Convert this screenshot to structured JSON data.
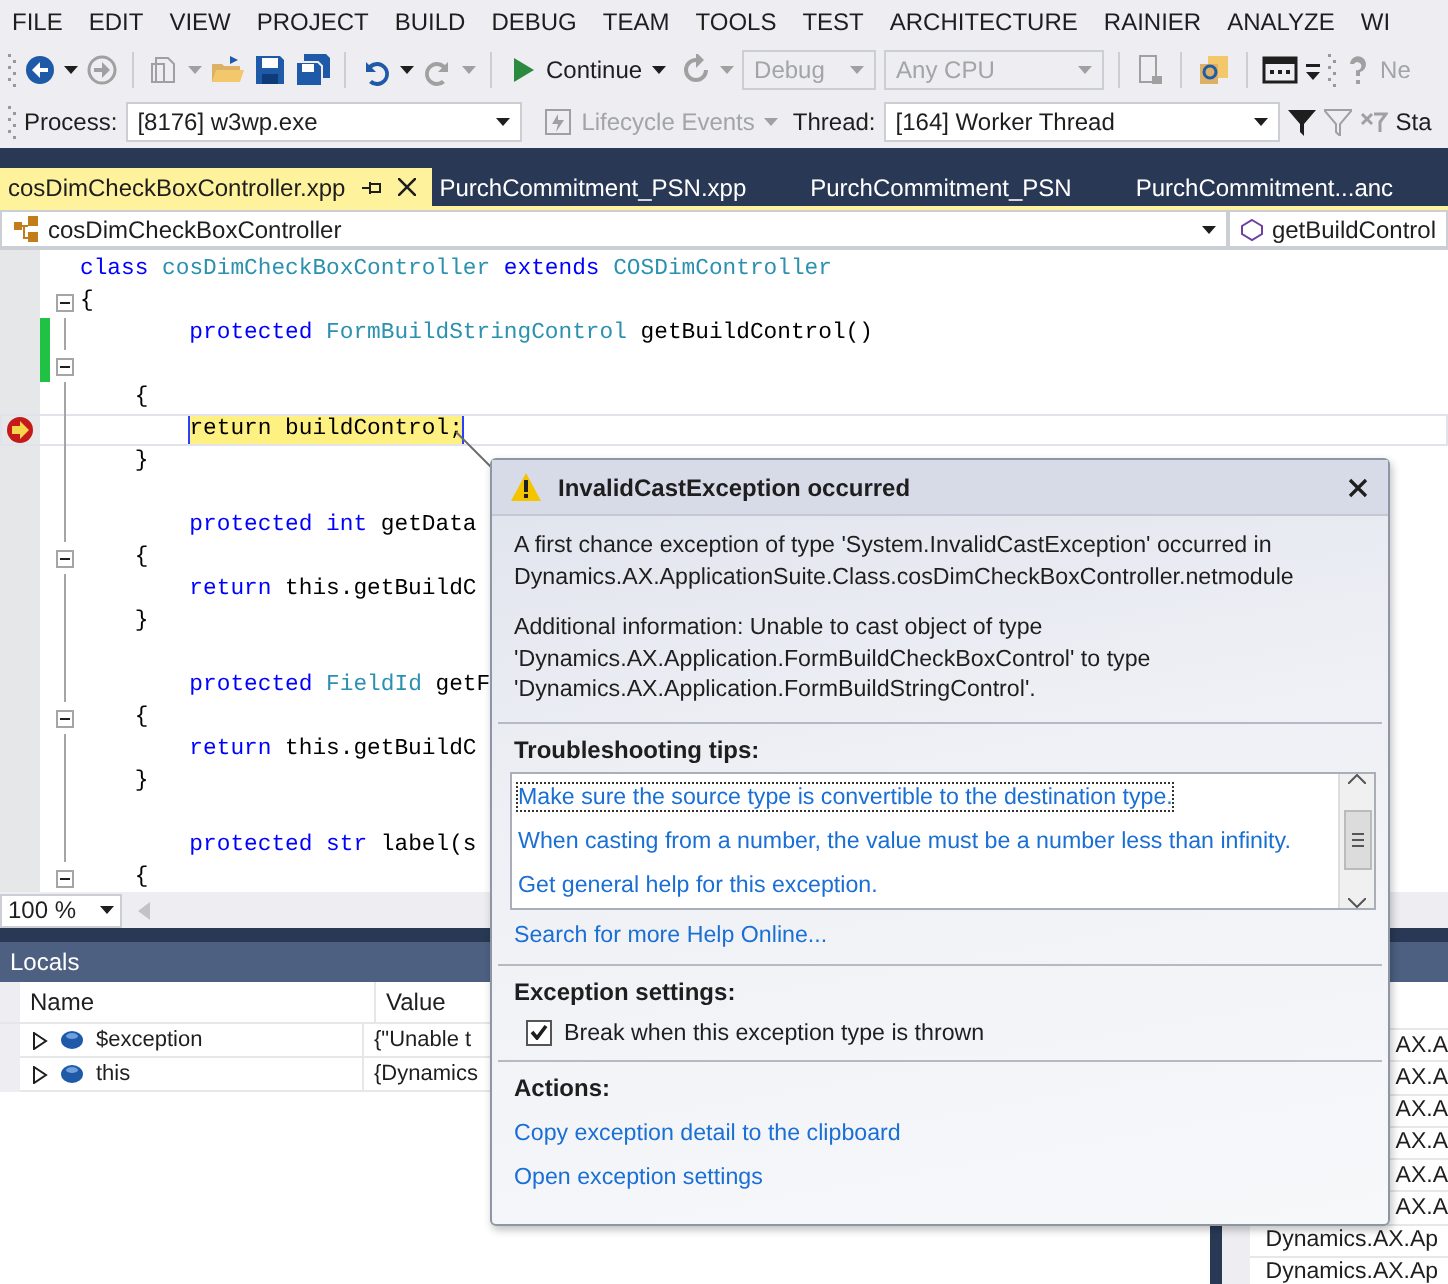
{
  "menu": [
    "FILE",
    "EDIT",
    "VIEW",
    "PROJECT",
    "BUILD",
    "DEBUG",
    "TEAM",
    "TOOLS",
    "TEST",
    "ARCHITECTURE",
    "RAINIER",
    "ANALYZE",
    "WI"
  ],
  "toolbar": {
    "continue": "Continue",
    "configuration": {
      "value": "Debug",
      "disabled": true
    },
    "platform": {
      "value": "Any CPU",
      "disabled": true
    },
    "cut_label": "Ne"
  },
  "debug_location": {
    "process_label": "Process:",
    "process": "[8176] w3wp.exe",
    "lifecycle": {
      "label": "Lifecycle Events",
      "disabled": true
    },
    "thread_label": "Thread:",
    "thread": "[164] Worker Thread",
    "cut_label": "Sta"
  },
  "tabs": [
    {
      "label": "cosDimCheckBoxController.xpp",
      "selected": true
    },
    {
      "label": "PurchCommitment_PSN.xpp",
      "selected": false
    },
    {
      "label": "PurchCommitment_PSN",
      "selected": false
    },
    {
      "label": "PurchCommitment...anc",
      "selected": false
    }
  ],
  "navigation": {
    "type": "cosDimCheckBoxController",
    "member": "getBuildControl"
  },
  "code": [
    {
      "tokens": [
        {
          "text": "class",
          "kind": "keyword"
        },
        {
          "text": " cosDimCheckBoxController",
          "kind": "type"
        },
        {
          "text": " extends",
          "kind": "keyword"
        },
        {
          "text": " COSDimController",
          "kind": "type"
        }
      ],
      "current": false,
      "changed": false,
      "fold": false
    },
    {
      "tokens": [
        {
          "text": "{",
          "kind": "plain"
        }
      ],
      "current": false,
      "changed": false,
      "fold": true
    },
    {
      "tokens": [
        {
          "text": "        protected",
          "kind": "keyword"
        },
        {
          "text": " FormBuildStringControl",
          "kind": "type"
        },
        {
          "text": " getBuildControl()",
          "kind": "plain"
        }
      ],
      "current": false,
      "changed": true,
      "fold": false
    },
    {
      "current": false,
      "changed": true,
      "fold": true
    },
    {
      "tokens": [
        {
          "text": "    {",
          "kind": "plain"
        }
      ],
      "current": false,
      "changed": false,
      "fold": false
    },
    {
      "tokens": [
        {
          "text": "        return",
          "kind": "plain"
        },
        {
          "text": " buildControl;",
          "kind": "plain"
        }
      ],
      "current": true,
      "changed": false,
      "fold": false
    },
    {
      "tokens": [
        {
          "text": "    }",
          "kind": "plain"
        }
      ],
      "current": false,
      "changed": false,
      "fold": false
    },
    {
      "current": false,
      "changed": false,
      "fold": false
    },
    {
      "tokens": [
        {
          "text": "        protected",
          "kind": "keyword"
        },
        {
          "text": " int",
          "kind": "keyword"
        },
        {
          "text": " getData",
          "kind": "plain"
        }
      ],
      "current": false,
      "changed": false,
      "fold": false
    },
    {
      "tokens": [
        {
          "text": "    {",
          "kind": "plain"
        }
      ],
      "current": false,
      "changed": false,
      "fold": true
    },
    {
      "tokens": [
        {
          "text": "        return",
          "kind": "keyword"
        },
        {
          "text": " this.getBuildC",
          "kind": "plain"
        }
      ],
      "current": false,
      "changed": false,
      "fold": false
    },
    {
      "tokens": [
        {
          "text": "    }",
          "kind": "plain"
        }
      ],
      "current": false,
      "changed": false,
      "fold": false
    },
    {
      "current": false,
      "changed": false,
      "fold": false
    },
    {
      "tokens": [
        {
          "text": "        protected",
          "kind": "keyword"
        },
        {
          "text": " FieldId",
          "kind": "type"
        },
        {
          "text": " getF",
          "kind": "plain"
        }
      ],
      "current": false,
      "changed": false,
      "fold": false
    },
    {
      "tokens": [
        {
          "text": "    {",
          "kind": "plain"
        }
      ],
      "current": false,
      "changed": false,
      "fold": true
    },
    {
      "tokens": [
        {
          "text": "        return",
          "kind": "keyword"
        },
        {
          "text": " this.getBuildC",
          "kind": "plain"
        }
      ],
      "current": false,
      "changed": false,
      "fold": false
    },
    {
      "tokens": [
        {
          "text": "    }",
          "kind": "plain"
        }
      ],
      "current": false,
      "changed": false,
      "fold": false
    },
    {
      "current": false,
      "changed": false,
      "fold": false
    },
    {
      "tokens": [
        {
          "text": "        protected",
          "kind": "keyword"
        },
        {
          "text": " str",
          "kind": "keyword"
        },
        {
          "text": " label(s",
          "kind": "plain"
        }
      ],
      "current": false,
      "changed": false,
      "fold": false
    },
    {
      "tokens": [
        {
          "text": "    {",
          "kind": "plain"
        }
      ],
      "current": false,
      "changed": false,
      "fold": true
    }
  ],
  "zoom": "100 %",
  "popup": {
    "title": "InvalidCastException occurred",
    "message": "A first chance exception of type 'System.InvalidCastException' occurred in\nDynamics.AX.ApplicationSuite.Class.cosDimCheckBoxController.netmodule",
    "details": "Additional information: Unable to cast object of type\n'Dynamics.AX.Application.FormBuildCheckBoxControl' to type\n'Dynamics.AX.Application.FormBuildStringControl'.",
    "tips_heading": "Troubleshooting tips:",
    "tips": [
      {
        "text": "Make sure the source type is convertible to the destination type.",
        "focused": true
      },
      {
        "text": "When casting from a number, the value must be a number less than infinity.",
        "focused": false
      },
      {
        "text": "Get general help for this exception.",
        "focused": false
      }
    ],
    "search_link": "Search for more Help Online...",
    "settings_heading": "Exception settings:",
    "break_option": {
      "label": "Break when this exception type is thrown",
      "checked": true
    },
    "actions_heading": "Actions:",
    "actions": [
      "Copy exception detail to the clipboard",
      "Open exception settings"
    ]
  },
  "locals": {
    "title": "Locals",
    "columns": [
      "Name",
      "Value"
    ],
    "rows": [
      {
        "name": "$exception",
        "value": "{\"Unable t",
        "expanded": false
      },
      {
        "name": "this",
        "value": "{Dynamics",
        "expanded": false
      }
    ]
  },
  "side_panel": {
    "rows": [
      {
        "text": "AX.A",
        "kind": "partial"
      },
      {
        "text": "AX.A",
        "kind": "partial"
      },
      {
        "text": "AX.A",
        "kind": "partial"
      },
      {
        "text": "AX.A",
        "kind": "partial"
      },
      {
        "text": "AX.A",
        "kind": "partial"
      },
      {
        "text": "AX.A",
        "kind": "partial"
      },
      {
        "text": "Dynamics.AX.Ap",
        "kind": "full"
      },
      {
        "text": "Dynamics.AX.Ap",
        "kind": "full"
      }
    ]
  }
}
